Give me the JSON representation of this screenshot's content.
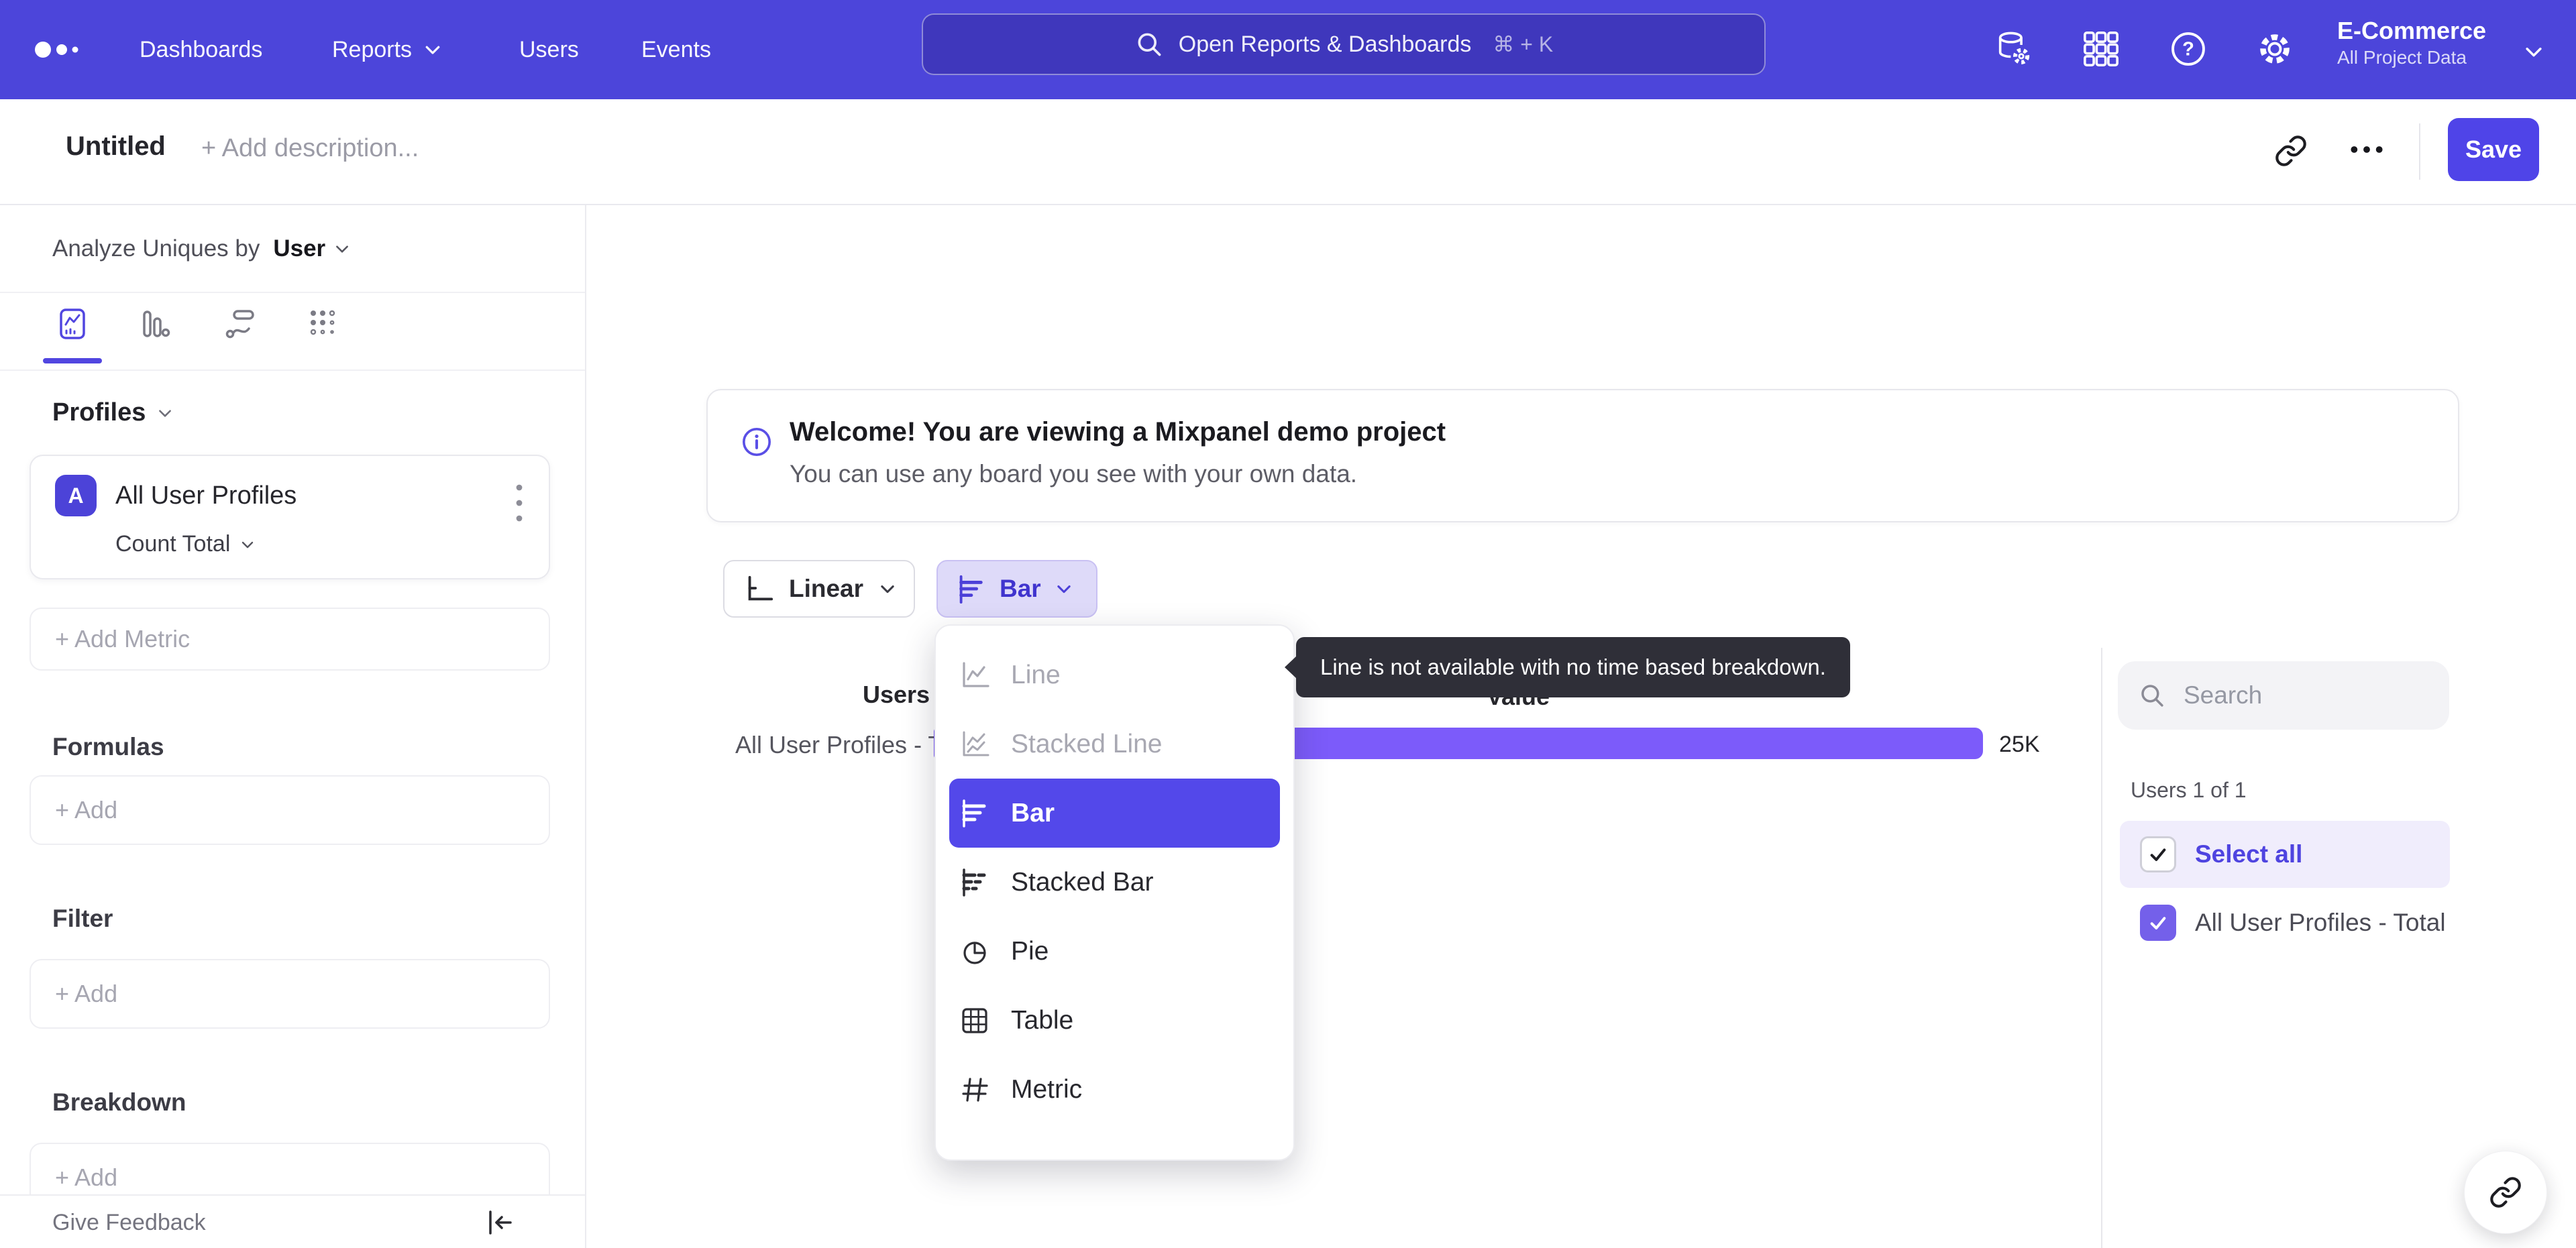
{
  "nav": {
    "items": [
      {
        "label": "Dashboards"
      },
      {
        "label": "Reports"
      },
      {
        "label": "Users"
      },
      {
        "label": "Events"
      }
    ],
    "search": {
      "placeholder": "Open Reports & Dashboards",
      "shortcut": "⌘ + K"
    },
    "project": {
      "name": "E-Commerce",
      "scope": "All Project Data"
    }
  },
  "header": {
    "title": "Untitled",
    "description_placeholder": "+ Add description...",
    "save_label": "Save"
  },
  "sidebar": {
    "analyze": {
      "prefix": "Analyze Uniques by",
      "value": "User"
    },
    "profiles": {
      "label": "Profiles",
      "metric": {
        "badge": "A",
        "name": "All User Profiles",
        "aggregation": "Count Total"
      },
      "add_label": "+ Add Metric"
    },
    "formulas": {
      "label": "Formulas",
      "add_label": "+ Add"
    },
    "filter": {
      "label": "Filter",
      "add_label": "+ Add"
    },
    "breakdown": {
      "label": "Breakdown",
      "add_label": "+ Add"
    },
    "footer": {
      "feedback_label": "Give Feedback"
    }
  },
  "main": {
    "banner": {
      "title": "Welcome! You are viewing a Mixpanel demo project",
      "subtitle": "You can use any board you see with your own data."
    },
    "controls": {
      "scale_label": "Linear",
      "chart_type_label": "Bar"
    },
    "dropdown": {
      "items": [
        {
          "label": "Line",
          "state": "disabled"
        },
        {
          "label": "Stacked Line",
          "state": "disabled"
        },
        {
          "label": "Bar",
          "state": "selected"
        },
        {
          "label": "Stacked Bar",
          "state": "default"
        },
        {
          "label": "Pie",
          "state": "default"
        },
        {
          "label": "Table",
          "state": "default"
        },
        {
          "label": "Metric",
          "state": "default"
        }
      ]
    },
    "tooltip": {
      "text": "Line is not available with no time based breakdown."
    },
    "table": {
      "users_header": "Users",
      "value_header": "Value",
      "row_label": "All User Profiles - Total",
      "value_display": "25K"
    }
  },
  "legend": {
    "search_placeholder": "Search",
    "count_label": "Users 1 of 1",
    "select_all_label": "Select all",
    "items": [
      {
        "label": "All User Profiles - Total",
        "checked": true
      }
    ]
  },
  "chart_data": {
    "type": "bar",
    "orientation": "horizontal",
    "categories": [
      "All User Profiles - Total"
    ],
    "values": [
      25000
    ],
    "value_labels": [
      "25K"
    ],
    "xlabel": "Value",
    "ylabel": "Users",
    "legend_position": "right",
    "color": "#7c5bfa"
  },
  "icons": {
    "logo": "three-dots",
    "search": "magnifier",
    "data": "database-gear",
    "apps": "grid-3x3",
    "help": "question-circle",
    "settings": "gear",
    "share": "chain-link",
    "more": "ellipsis",
    "info": "info-circle",
    "collapse": "bar-arrow-left"
  },
  "colors": {
    "nav_bg": "#4c45da",
    "accent": "#4f44e8",
    "accent_dark": "#4034ce",
    "selected_item_bg": "#5348ea",
    "bar_fill": "#7c5bfa",
    "chart_type_btn_bg": "#dedaf9",
    "select_all_bg": "#f0edfc",
    "tooltip_bg": "#2f2f38"
  }
}
